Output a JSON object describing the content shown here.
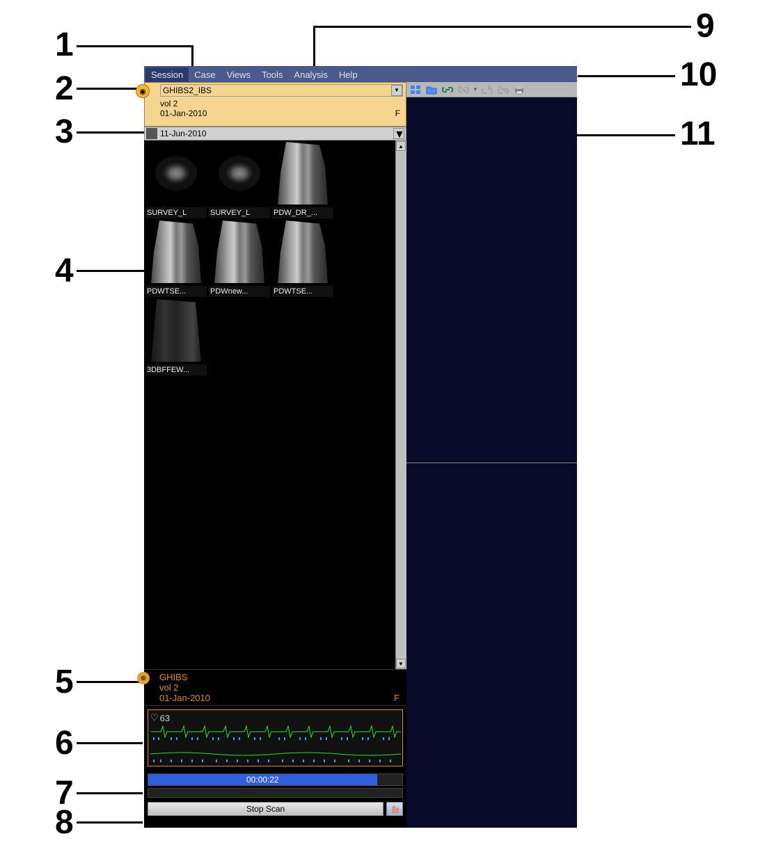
{
  "callouts": {
    "1": "1",
    "2": "2",
    "3": "3",
    "4": "4",
    "5": "5",
    "6": "6",
    "7": "7",
    "8": "8",
    "9": "9",
    "10": "10",
    "11": "11"
  },
  "menu": {
    "session": "Session",
    "case": "Case",
    "views": "Views",
    "tools": "Tools",
    "analysis": "Analysis",
    "help": "Help"
  },
  "patient": {
    "name": "GHIBS2_IBS",
    "vol": "vol 2",
    "dob": "01-Jan-2010",
    "sex": "F"
  },
  "exam": {
    "date": "11-Jun-2010"
  },
  "thumbnails": [
    {
      "label": "SURVEY_L",
      "type": "axial"
    },
    {
      "label": "SURVEY_L",
      "type": "axial"
    },
    {
      "label": "PDW_DR_...",
      "type": "sagittal"
    },
    {
      "label": "PDWTSE...",
      "type": "sagittal"
    },
    {
      "label": "PDWnew...",
      "type": "sagittal"
    },
    {
      "label": "PDWTSE...",
      "type": "sagittal"
    },
    {
      "label": "3DBFFEW...",
      "type": "dark"
    }
  ],
  "scan": {
    "patient_name": "GHIBS",
    "vol": "vol 2",
    "dob": "01-Jan-2010",
    "sex": "F",
    "heart_rate": "63",
    "progress_time": "00:00:22",
    "stop_button": "Stop Scan"
  }
}
